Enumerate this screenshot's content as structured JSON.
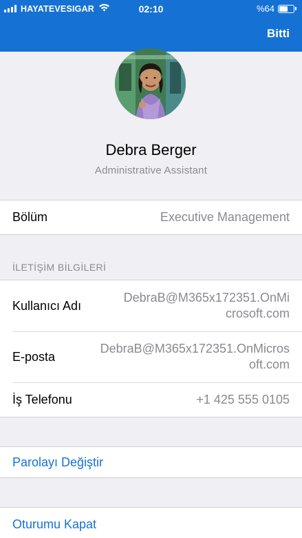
{
  "status": {
    "carrier": "HAYATEVESIGAR",
    "time": "02:10",
    "battery_text": "%64",
    "battery_level": 0.64
  },
  "header": {
    "done_label": "Bitti"
  },
  "profile": {
    "name": "Debra Berger",
    "title": "Administrative Assistant"
  },
  "department": {
    "label": "Bölüm",
    "value": "Executive Management"
  },
  "contact": {
    "section_title": "İLETİŞİM BİLGİLERİ",
    "username": {
      "label": "Kullanıcı Adı",
      "value_line1": "DebraB@M365x172351.OnMi",
      "value_line2": "crosoft.com"
    },
    "email": {
      "label": "E-posta",
      "value_line1": "DebraB@M365x172351.OnMicros",
      "value_line2": "oft.com"
    },
    "work_phone": {
      "label": "İş Telefonu",
      "value": "+1 425 555 0105"
    }
  },
  "actions": {
    "change_password": "Parolayı Değiştir",
    "sign_out": "Oturumu Kapat"
  },
  "colors": {
    "accent": "#1572d4",
    "background": "#efeff4"
  }
}
